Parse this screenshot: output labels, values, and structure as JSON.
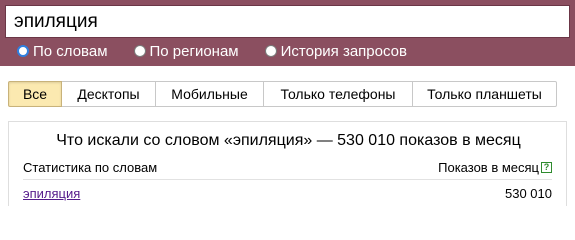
{
  "search": {
    "value": "эпиляция"
  },
  "mode_options": [
    {
      "label": "По словам",
      "checked": true
    },
    {
      "label": "По регионам",
      "checked": false
    },
    {
      "label": "История запросов",
      "checked": false
    }
  ],
  "device_tabs": [
    {
      "label": "Все",
      "active": true
    },
    {
      "label": "Десктопы",
      "active": false
    },
    {
      "label": "Мобильные",
      "active": false
    },
    {
      "label": "Только телефоны",
      "active": false
    },
    {
      "label": "Только планшеты",
      "active": false
    }
  ],
  "stats": {
    "title": "Что искали со словом «эпиляция» — 530 010 показов в месяц",
    "col_left": "Статистика по словам",
    "col_right": "Показов в месяц",
    "help_icon": "?",
    "rows": [
      {
        "phrase": "эпиляция",
        "count": "530 010"
      }
    ]
  },
  "colors": {
    "header_bg": "#8b4f60",
    "active_tab_bg": "#fbe9b0",
    "link_color": "#551a8b",
    "radio_accent": "#2f7fe0"
  }
}
